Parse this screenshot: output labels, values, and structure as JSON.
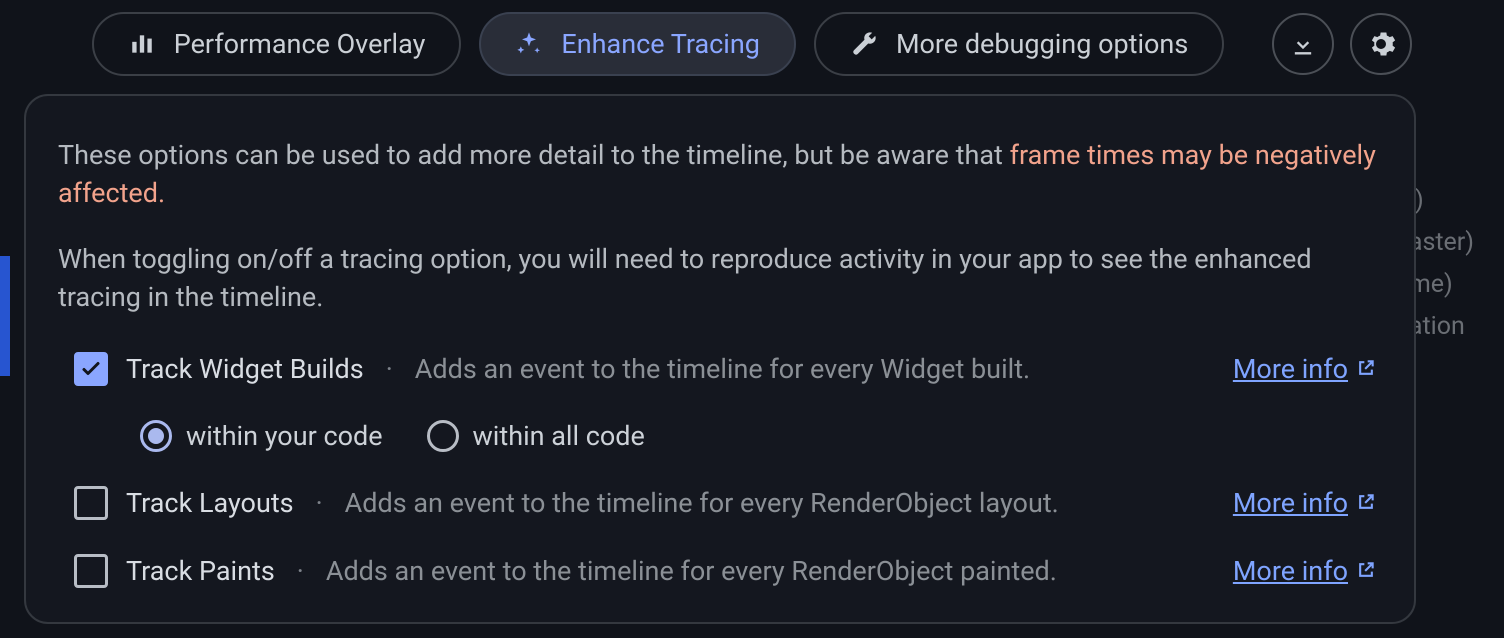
{
  "tabs": {
    "performance_overlay": "Performance Overlay",
    "enhance_tracing": "Enhance Tracing",
    "more_debugging": "More debugging options"
  },
  "icon_buttons": {
    "download": "download-icon",
    "settings": "gear-icon"
  },
  "bg_hints": {
    "l1": "l)",
    "l2": "aster)",
    "l3": "me)",
    "l4": "ation"
  },
  "panel": {
    "intro_plain_prefix": "These options can be used to add more detail to the timeline, but be aware that ",
    "intro_warn": "frame times may be negatively affected",
    "intro_period": ".",
    "intro_second": "When toggling on/off a tracing option, you will need to reproduce activity in your app to see the enhanced tracing in the timeline."
  },
  "more_info_label": "More info",
  "options": [
    {
      "checked": true,
      "label": "Track Widget Builds",
      "desc": "Adds an event to the timeline for every Widget built.",
      "radios": [
        {
          "label": "within your code",
          "selected": true
        },
        {
          "label": "within all code",
          "selected": false
        }
      ]
    },
    {
      "checked": false,
      "label": "Track Layouts",
      "desc": "Adds an event to the timeline for every RenderObject layout."
    },
    {
      "checked": false,
      "label": "Track Paints",
      "desc": "Adds an event to the timeline for every RenderObject painted."
    }
  ]
}
